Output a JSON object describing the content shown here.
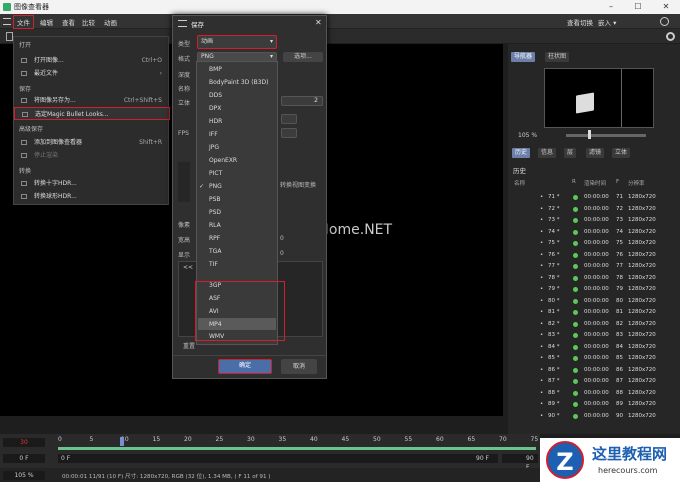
{
  "window": {
    "title": "图像查看器",
    "min": "–",
    "max": "☐",
    "close": "✕"
  },
  "menubar": {
    "items": [
      "文件",
      "编辑",
      "查看",
      "比较",
      "动画"
    ],
    "right": [
      "查看切换",
      "嵌入 ▾"
    ]
  },
  "file_menu": {
    "items": [
      {
        "label": "打开",
        "type": "head"
      },
      {
        "label": "打开图像...",
        "shortcut": "Ctrl+O"
      },
      {
        "label": "最近文件",
        "shortcut": "›"
      },
      {
        "label": "保存",
        "type": "head"
      },
      {
        "label": "将图像另存为...",
        "shortcut": "Ctrl+Shift+S"
      },
      {
        "label": "选定Magic Bullet Looks...",
        "shortcut": ""
      },
      {
        "label": "高级保存",
        "type": "head"
      },
      {
        "label": "添加到图像查看器",
        "shortcut": "Shift+R"
      },
      {
        "label": "停止渲染",
        "type": "dis"
      },
      {
        "label": "转换",
        "type": "head"
      },
      {
        "label": "转换十字HDR...",
        "shortcut": ""
      },
      {
        "label": "转换球形HDR...",
        "shortcut": ""
      }
    ]
  },
  "dialog": {
    "title": "保存",
    "close": "✕",
    "type_label": "类型",
    "type_value": "动画",
    "format_label": "格式",
    "format_value": "PNG",
    "options_btn": "选项...",
    "labels": [
      "深度",
      "名称",
      "立体",
      "",
      "FPS"
    ],
    "value_2": "2",
    "side_labels": [
      "像素",
      "宽高",
      "显示"
    ],
    "convert_text": "转换视图变换",
    "zero": "0",
    "misc": "<<",
    "reset": "重置",
    "ok": "确定",
    "cancel": "取消"
  },
  "formats": [
    "BMP",
    "BodyPaint 3D (B3D)",
    "DDS",
    "DPX",
    "HDR",
    "IFF",
    "JPG",
    "OpenEXR",
    "PICT",
    "PNG",
    "PSB",
    "PSD",
    "RLA",
    "RPF",
    "TGA",
    "TIF",
    "3GP",
    "ASF",
    "AVI",
    "MP4",
    "WMV"
  ],
  "format_checked": "PNG",
  "right_panel": {
    "tabs_top": [
      "导航器",
      "柱状图"
    ],
    "zoom": "105 %",
    "tabs": [
      "历史",
      "信息",
      "层",
      "滤镜",
      "立体"
    ],
    "history_title": "历史",
    "cols": [
      "名称",
      "R",
      "渲染时间",
      "F",
      "分辨率"
    ],
    "rows": [
      {
        "n": "71 *",
        "t": "00:00:00",
        "f": "71",
        "r": "1280x720"
      },
      {
        "n": "72 *",
        "t": "00:00:00",
        "f": "72",
        "r": "1280x720"
      },
      {
        "n": "73 *",
        "t": "00:00:00",
        "f": "73",
        "r": "1280x720"
      },
      {
        "n": "74 *",
        "t": "00:00:00",
        "f": "74",
        "r": "1280x720"
      },
      {
        "n": "75 *",
        "t": "00:00:00",
        "f": "75",
        "r": "1280x720"
      },
      {
        "n": "76 *",
        "t": "00:00:00",
        "f": "76",
        "r": "1280x720"
      },
      {
        "n": "77 *",
        "t": "00:00:00",
        "f": "77",
        "r": "1280x720"
      },
      {
        "n": "78 *",
        "t": "00:00:00",
        "f": "78",
        "r": "1280x720"
      },
      {
        "n": "79 *",
        "t": "00:00:00",
        "f": "79",
        "r": "1280x720"
      },
      {
        "n": "80 *",
        "t": "00:00:00",
        "f": "80",
        "r": "1280x720"
      },
      {
        "n": "81 *",
        "t": "00:00:00",
        "f": "81",
        "r": "1280x720"
      },
      {
        "n": "82 *",
        "t": "00:00:00",
        "f": "82",
        "r": "1280x720"
      },
      {
        "n": "83 *",
        "t": "00:00:00",
        "f": "83",
        "r": "1280x720"
      },
      {
        "n": "84 *",
        "t": "00:00:00",
        "f": "84",
        "r": "1280x720"
      },
      {
        "n": "85 *",
        "t": "00:00:00",
        "f": "85",
        "r": "1280x720"
      },
      {
        "n": "86 *",
        "t": "00:00:00",
        "f": "86",
        "r": "1280x720"
      },
      {
        "n": "87 *",
        "t": "00:00:00",
        "f": "87",
        "r": "1280x720"
      },
      {
        "n": "88 *",
        "t": "00:00:00",
        "f": "88",
        "r": "1280x720"
      },
      {
        "n": "89 *",
        "t": "00:00:00",
        "f": "89",
        "r": "1280x720"
      },
      {
        "n": "90 *",
        "t": "00:00:00",
        "f": "90",
        "r": "1280x720"
      }
    ]
  },
  "timeline": {
    "frame": "30",
    "start": "0 F",
    "end": "90 F",
    "end2": "90 F",
    "ticks": [
      "0",
      "5",
      "10",
      "15",
      "20",
      "25",
      "30",
      "35",
      "40",
      "45",
      "50",
      "55",
      "60",
      "65",
      "70",
      "75"
    ]
  },
  "status": {
    "zoom": "105 %",
    "info": "00:00:01 11/91 (10 F)  尺寸: 1280x720, RGB (32 位), 1.34 MB,  ( F 11 of 91 )"
  },
  "watermark": "www.pHome.NET",
  "logo": {
    "letter": "Z",
    "title": "这里教程网",
    "url": "herecours.com"
  },
  "colors": {
    "accent": "#4a6ea8",
    "highlight": "#d02030",
    "ok_dot": "#5cc85c"
  }
}
